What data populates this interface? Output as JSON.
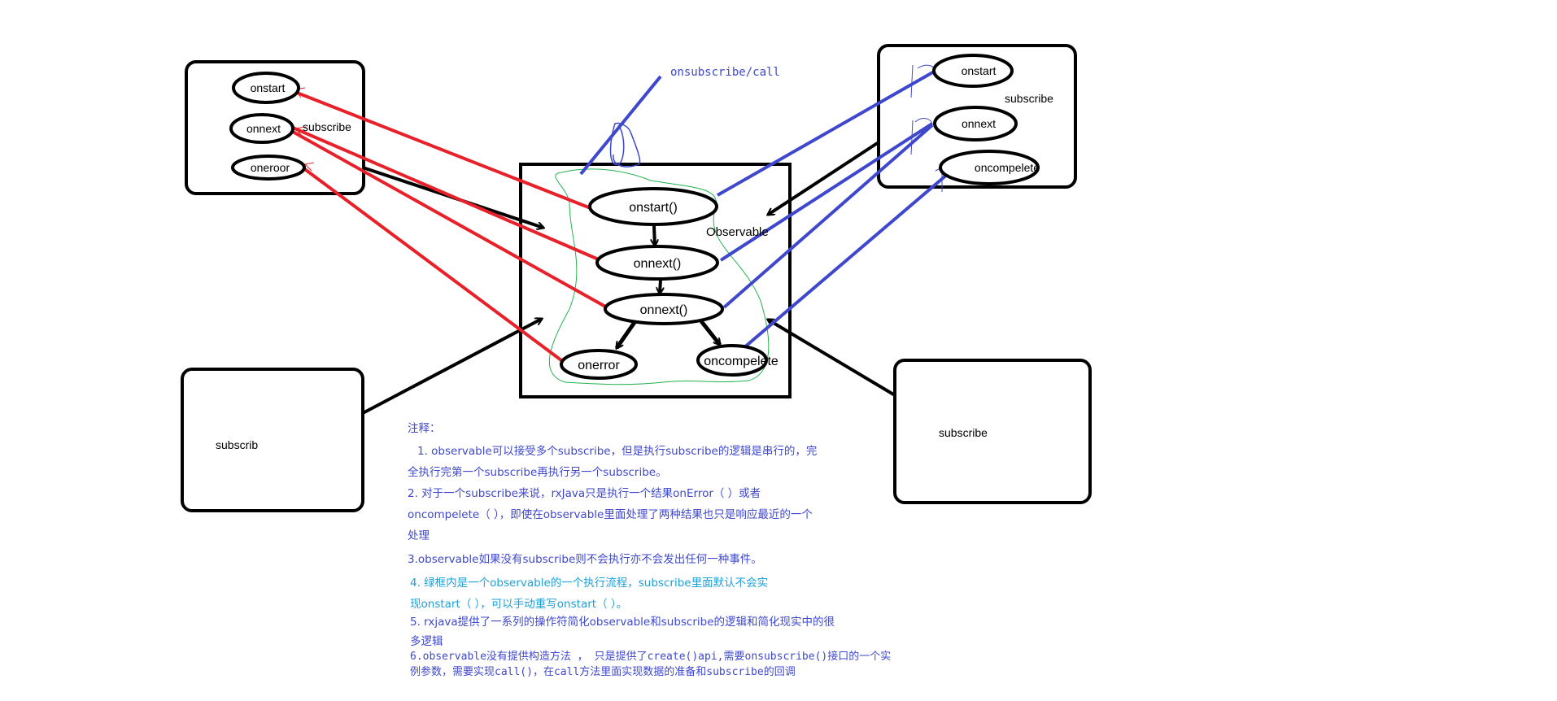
{
  "colors": {
    "black": "#000000",
    "red": "#e8202a",
    "blue": "#3f48cc",
    "green": "#22b14c",
    "note_blue": "#3f48cc",
    "note_cyan": "#1e9fd8"
  },
  "diagram": {
    "top_label": "onsubscribe/call",
    "observable_label": "Observable",
    "flow_nodes": {
      "onstart": "onstart()",
      "onnext1": "onnext()",
      "onnext2": "onnext()",
      "onerror": "onerror",
      "oncompelete": "oncompelete"
    },
    "left_subscriber": {
      "label": "subscribe",
      "nodes": [
        "onstart",
        "onnext",
        "oneroor"
      ]
    },
    "right_subscriber": {
      "label": "subscribe",
      "nodes": [
        "onstart",
        "onnext",
        "oncompelete"
      ]
    },
    "bottom_left_label": "subscrib",
    "bottom_right_label": "subscribe"
  },
  "notes": {
    "heading": "注释：",
    "lines": [
      "1. observable可以接受多个subscribe，但是执行subscribe的逻辑是串行的，完",
      "全执行完第一个subscribe再执行另一个subscribe。",
      "2. 对于一个subscribe来说，rxJava只是执行一个结果onError（ ）或者",
      "oncompelete（ ），即使在observable里面处理了两种结果也只是响应最近的一个",
      "处理",
      "3.observable如果没有subscribe则不会执行亦不会发出任何一种事件。",
      "4. 绿框内是一个observable的一个执行流程，subscribe里面默认不会实",
      "现onstart（ ），可以手动重写onstart（ ）。",
      "5. rxjava提供了一系列的操作符简化observable和subscribe的逻辑和简化现实中的很",
      "多逻辑",
      "6.observable没有提供构造方法 ， 只是提供了create()api,需要onsubscribe()接口的一个实",
      "例参数，需要实现call()，在call方法里面实现数据的准备和subscribe的回调"
    ]
  }
}
